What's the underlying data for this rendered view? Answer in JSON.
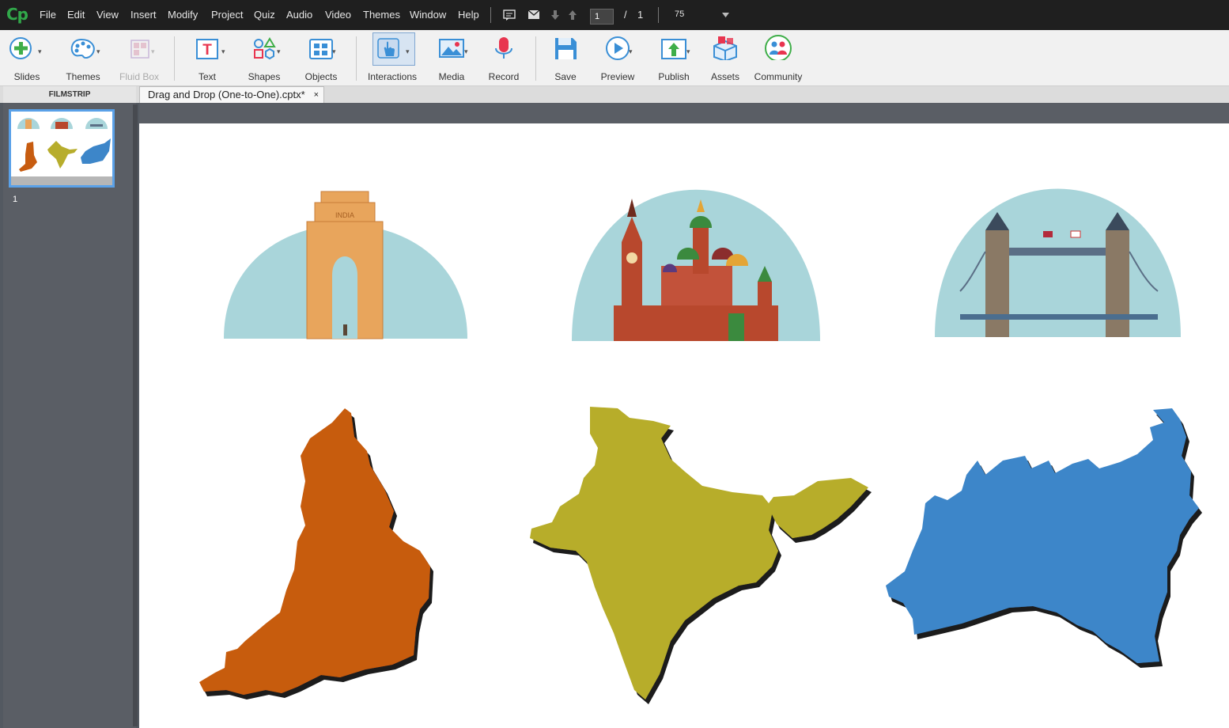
{
  "app": {
    "logo": "Cp"
  },
  "menu": [
    "File",
    "Edit",
    "View",
    "Insert",
    "Modify",
    "Project",
    "Quiz",
    "Audio",
    "Video",
    "Themes",
    "Window",
    "Help"
  ],
  "nav": {
    "current_slide": "1",
    "separator": "/",
    "total_slides": "1",
    "zoom": "75"
  },
  "toolbar": {
    "slides": "Slides",
    "themes": "Themes",
    "fluid_box": "Fluid Box",
    "text": "Text",
    "shapes": "Shapes",
    "objects": "Objects",
    "interactions": "Interactions",
    "media": "Media",
    "record": "Record",
    "save": "Save",
    "preview": "Preview",
    "publish": "Publish",
    "assets": "Assets",
    "community": "Community"
  },
  "panels": {
    "filmstrip_label": "FILMSTRIP",
    "document_tab": "Drag and Drop (One-to-One).cptx*",
    "close": "×"
  },
  "filmstrip": {
    "slide_number": "1"
  },
  "slide": {
    "landmarks": [
      "india-gate",
      "kremlin",
      "tower-bridge"
    ],
    "maps": [
      {
        "name": "england",
        "color": "#c75c10"
      },
      {
        "name": "india",
        "color": "#b7ad2c"
      },
      {
        "name": "russia",
        "color": "#3d86c9"
      }
    ],
    "dome_color": "#a9d5da"
  }
}
